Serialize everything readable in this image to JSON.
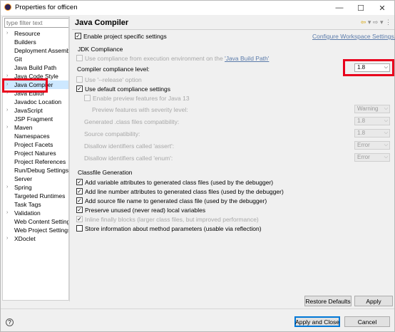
{
  "window": {
    "title": "Properties for officen",
    "min": "—",
    "max": "☐",
    "close": "✕"
  },
  "filter": {
    "placeholder": "type filter text"
  },
  "tree": [
    {
      "label": "Resource",
      "arrow": true
    },
    {
      "label": "Builders",
      "arrow": false
    },
    {
      "label": "Deployment Assemb",
      "arrow": false
    },
    {
      "label": "Git",
      "arrow": false
    },
    {
      "label": "Java Build Path",
      "arrow": false
    },
    {
      "label": "Java Code Style",
      "arrow": true
    },
    {
      "label": "Java Compiler",
      "arrow": true,
      "selected": true
    },
    {
      "label": "Java Editor",
      "arrow": true
    },
    {
      "label": "Javadoc Location",
      "arrow": false
    },
    {
      "label": "JavaScript",
      "arrow": true
    },
    {
      "label": "JSP Fragment",
      "arrow": false
    },
    {
      "label": "Maven",
      "arrow": true
    },
    {
      "label": "Namespaces",
      "arrow": false
    },
    {
      "label": "Project Facets",
      "arrow": false
    },
    {
      "label": "Project Natures",
      "arrow": false
    },
    {
      "label": "Project References",
      "arrow": false
    },
    {
      "label": "Run/Debug Settings",
      "arrow": false
    },
    {
      "label": "Server",
      "arrow": false
    },
    {
      "label": "Spring",
      "arrow": true
    },
    {
      "label": "Targeted Runtimes",
      "arrow": false
    },
    {
      "label": "Task Tags",
      "arrow": false
    },
    {
      "label": "Validation",
      "arrow": true
    },
    {
      "label": "Web Content Setting",
      "arrow": false
    },
    {
      "label": "Web Project Settings",
      "arrow": false
    },
    {
      "label": "XDoclet",
      "arrow": true
    }
  ],
  "page": {
    "heading": "Java Compiler",
    "enable_project": "Enable project specific settings",
    "configure_link": "Configure Workspace Settings...",
    "jdk_group": "JDK Compliance",
    "use_env_prefix": "Use compliance from execution environment on the ",
    "use_env_link": "'Java Build Path'",
    "compliance_label": "Compiler compliance level:",
    "compliance_value": "1.8",
    "release_option": "Use '--release' option",
    "default_settings": "Use default compliance settings",
    "preview_features": "Enable preview features for Java 13",
    "preview_severity": "Preview features with severity level:",
    "preview_severity_value": "Warning",
    "generated_compat": "Generated .class files compatibility:",
    "generated_compat_value": "1.8",
    "source_compat": "Source compatibility:",
    "source_compat_value": "1.8",
    "disallow_assert": "Disallow identifiers called 'assert':",
    "disallow_assert_value": "Error",
    "disallow_enum": "Disallow identifiers called 'enum':",
    "disallow_enum_value": "Error",
    "classfile_group": "Classfile Generation",
    "opt_variable": "Add variable attributes to generated class files (used by the debugger)",
    "opt_line": "Add line number attributes to generated class files (used by the debugger)",
    "opt_source": "Add source file name to generated class file (used by the debugger)",
    "opt_preserve": "Preserve unused (never read) local variables",
    "opt_inline": "Inline finally blocks (larger class files, but improved performance)",
    "opt_params": "Store information about method parameters (usable via reflection)",
    "check": "✓"
  },
  "buttons": {
    "restore": "Restore Defaults",
    "apply": "Apply",
    "apply_close": "Apply and Close",
    "cancel": "Cancel",
    "help": "?"
  },
  "nav": {
    "back": "⇦",
    "down1": "▾",
    "forward": "⇨",
    "down2": "▾",
    "menu": "⋮"
  },
  "colors": {
    "highlight": "#e8001c",
    "selection": "#cde8ff"
  }
}
